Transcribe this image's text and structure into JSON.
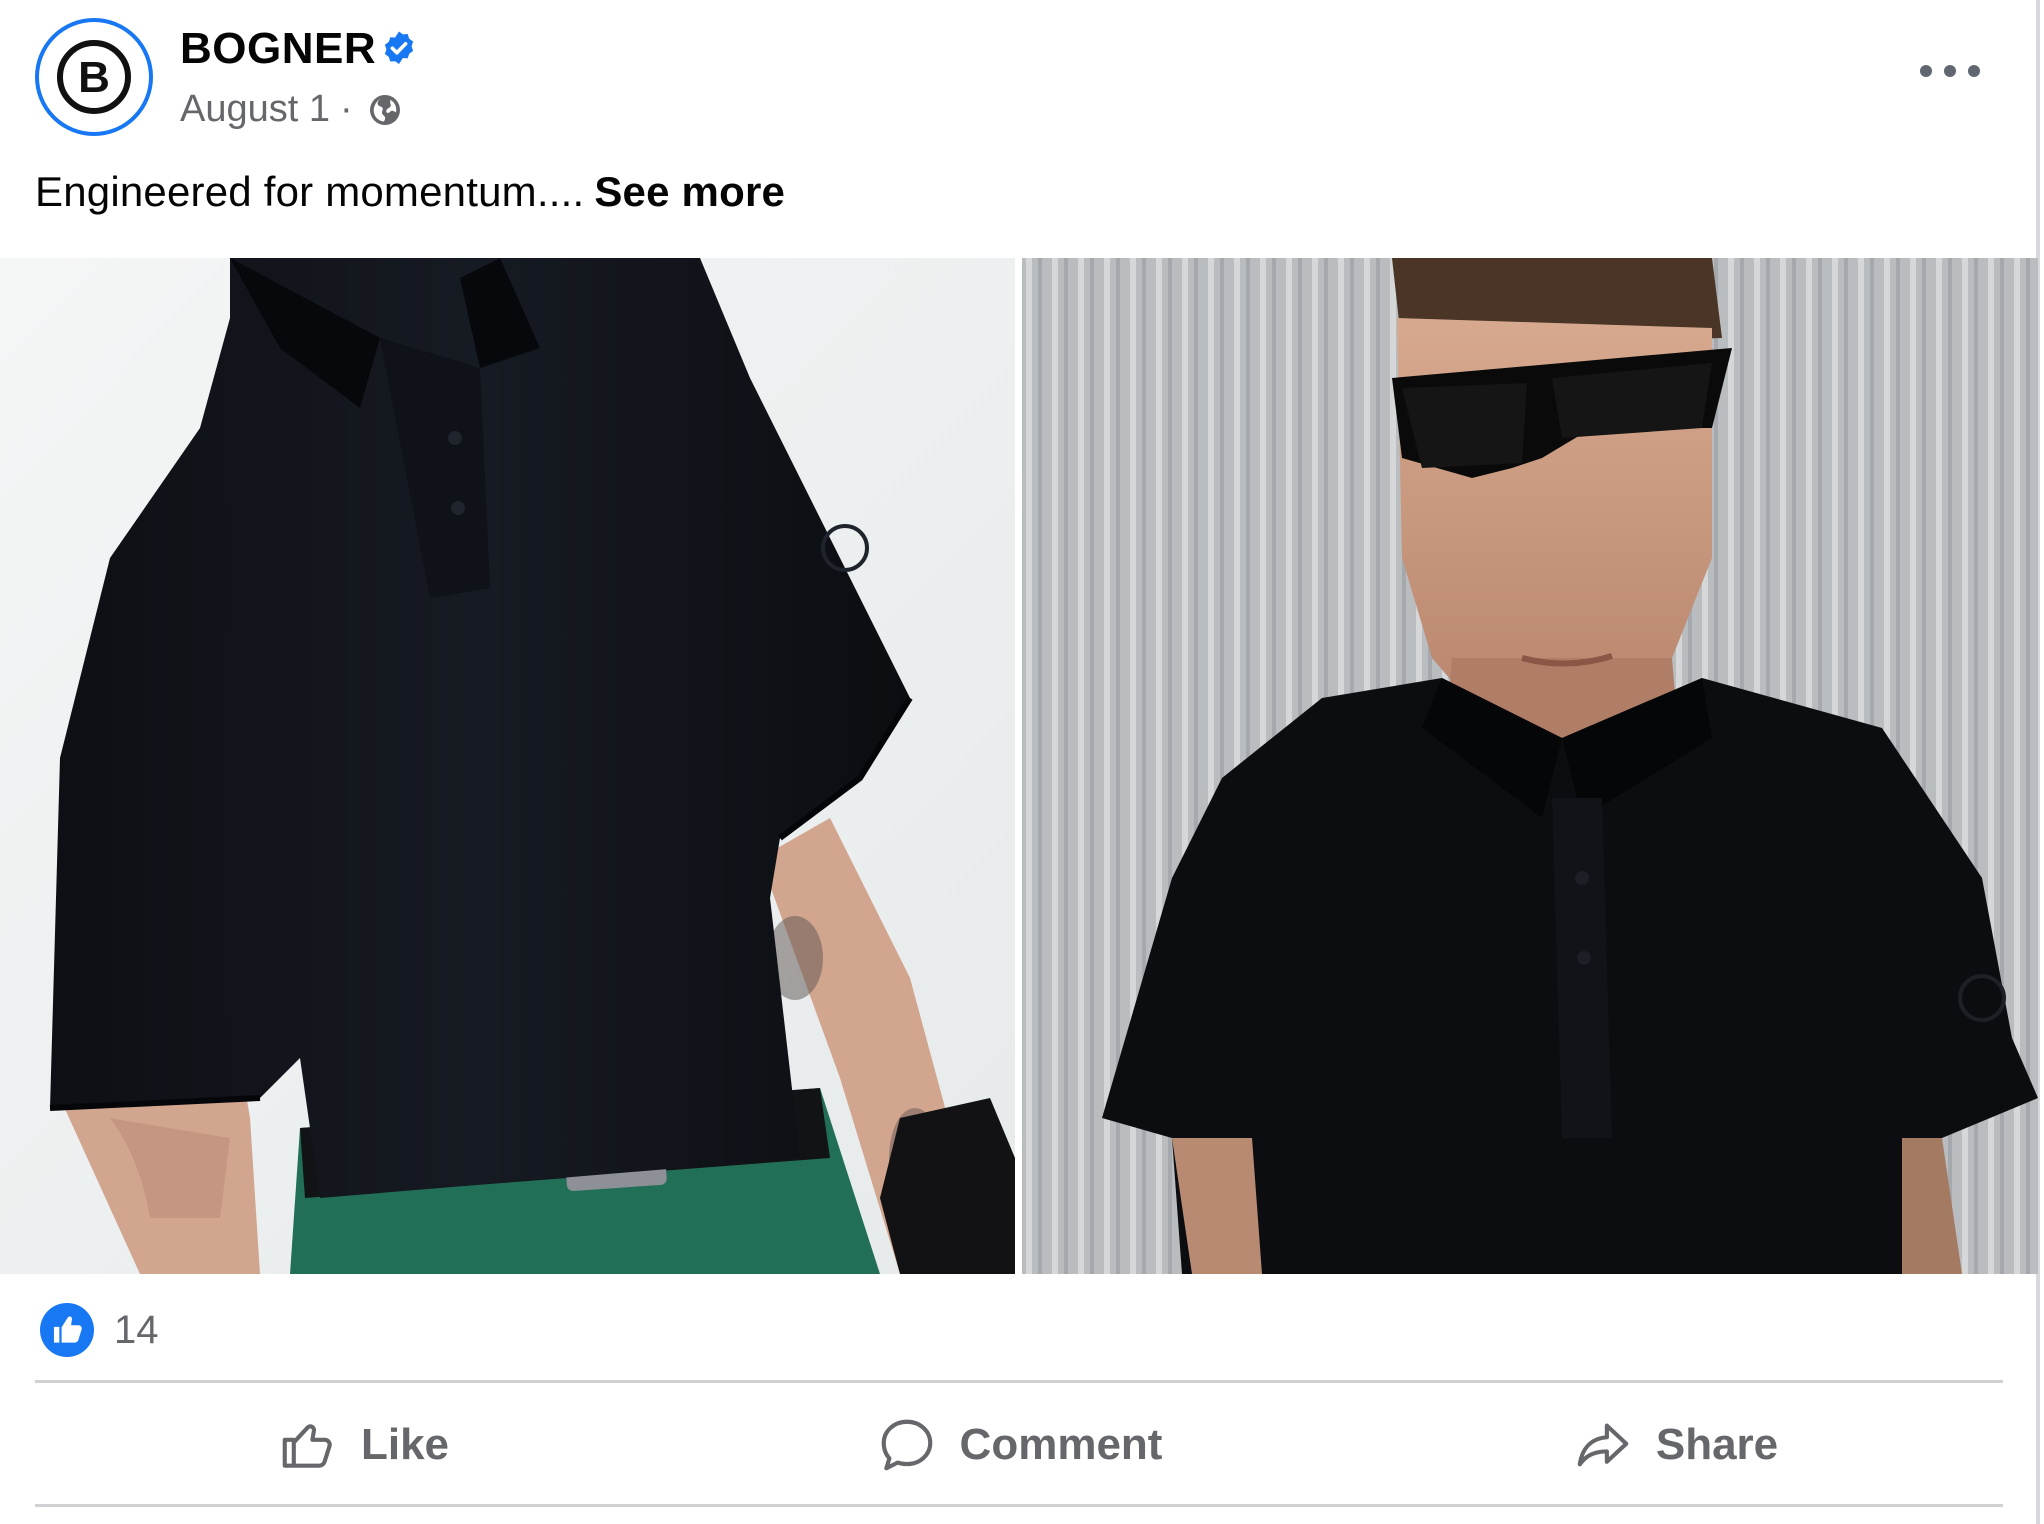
{
  "post": {
    "author": "BOGNER",
    "date": "August 1",
    "separator": "·",
    "verified": true,
    "audience_icon": "globe-icon",
    "caption": "Engineered for momentum....",
    "see_more": "See more",
    "reactions": {
      "icon": "like-reaction-icon",
      "count": "14"
    },
    "actions": [
      {
        "label": "Like",
        "icon": "thumbs-up-icon"
      },
      {
        "label": "Comment",
        "icon": "comment-icon"
      },
      {
        "label": "Share",
        "icon": "share-icon"
      }
    ]
  },
  "colors": {
    "brand_blue": "#1877f2",
    "secondary_text": "#65676b",
    "primary_text": "#050505",
    "divider": "#ced0d4"
  }
}
